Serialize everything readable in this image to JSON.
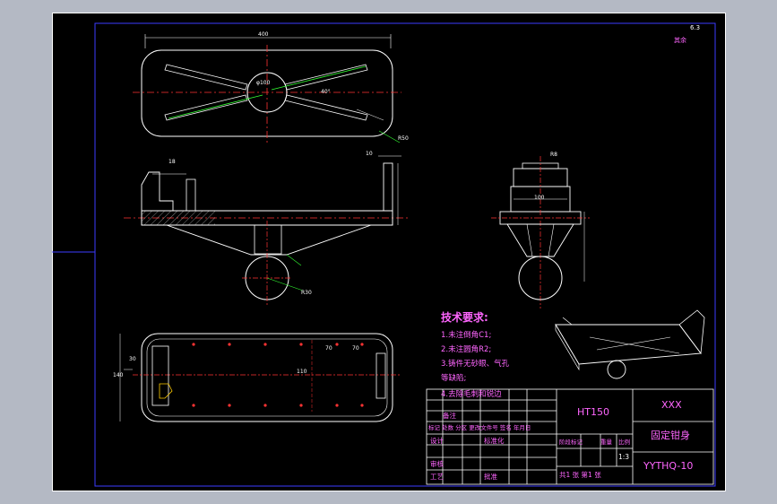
{
  "drawing": {
    "roughness_mark": "6.3",
    "roughness_label": "其余",
    "technical_requirements": {
      "title": "技术要求:",
      "items": [
        "1.未注倒角C1;",
        "2.未注圆角R2;",
        "3.铸件无砂眼、气孔",
        "等缺陷;",
        "4.去除毛刺和锐边"
      ]
    },
    "title_block": {
      "material": "HT150",
      "company": "XXX",
      "part_name": "固定钳身",
      "drawing_number": "YYTHQ-10",
      "scale": "1:3",
      "remark_label": "备注",
      "revision_row": "标记 处数 分区 更改文件号 签名 年月日",
      "design_label": "设计",
      "standardize_label": "标准化",
      "stage_label": "阶段标记",
      "weight_label": "重量",
      "scale_label": "比例",
      "review_label": "审核",
      "process_label": "工艺",
      "approve_label": "批准",
      "sheet_info": "共1 张 第1 张"
    },
    "dimensions": {
      "top_length": "400",
      "top_angle": "40°",
      "top_diameter": "φ100",
      "top_radius": "R50",
      "front_height": "18",
      "front_width": "10",
      "front_radius": "R30",
      "side_width": "100",
      "side_radius": "R8",
      "bottom_width": "110",
      "bottom_spacing_1": "70",
      "bottom_spacing_2": "70",
      "bottom_left": "30",
      "bottom_height": "140"
    }
  }
}
